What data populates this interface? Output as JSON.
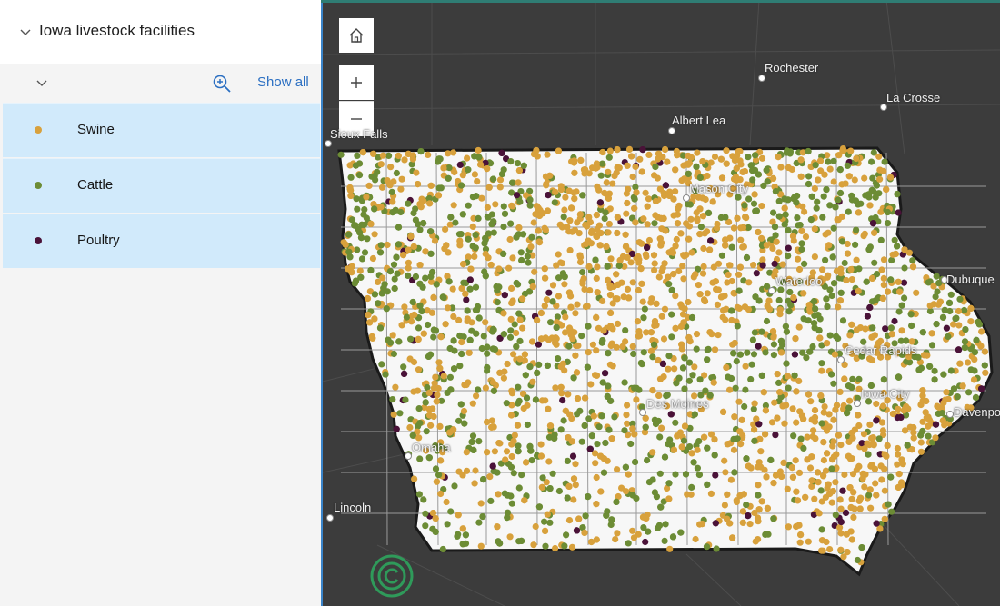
{
  "layer": {
    "title": "Iowa livestock facilities"
  },
  "toolbar": {
    "show_all": "Show all"
  },
  "legend": [
    {
      "label": "Swine",
      "color": "#d8a13c"
    },
    {
      "label": "Cattle",
      "color": "#6c8c35"
    },
    {
      "label": "Poultry",
      "color": "#4a1238"
    }
  ],
  "map": {
    "cities": [
      "Rochester",
      "La Crosse",
      "Albert Lea",
      "Sioux Falls",
      "Dubuque",
      "Des Moines",
      "Cedar Rapids",
      "Iowa City",
      "Davenport",
      "Omaha",
      "Lincoln",
      "Mason City",
      "Waterloo"
    ],
    "home_icon": "home-icon",
    "zoom_in_icon": "plus-icon",
    "zoom_out_icon": "minus-icon"
  }
}
